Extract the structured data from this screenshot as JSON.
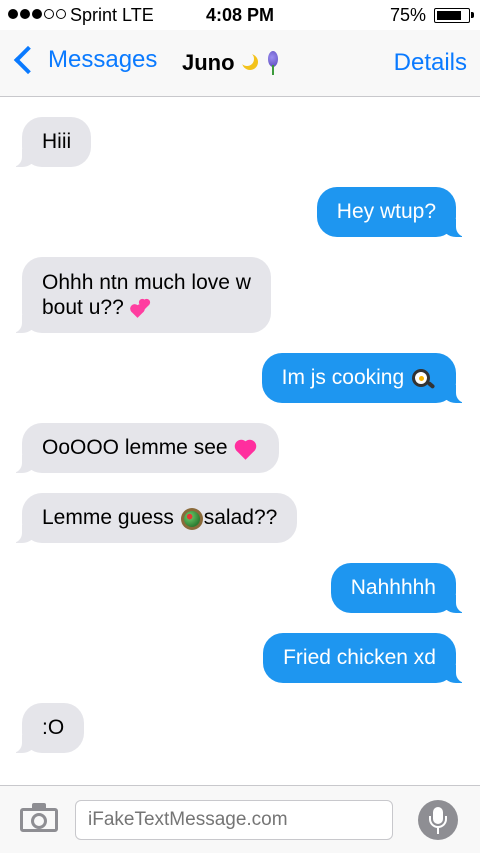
{
  "status_bar": {
    "carrier": "Sprint  LTE",
    "time": "4:08 PM",
    "battery_percent": "75%",
    "battery_level": 0.75,
    "signal_bars_filled": 3,
    "signal_bars_total": 5
  },
  "nav": {
    "back_label": "Messages",
    "contact_name": "Juno",
    "contact_emojis": [
      "crescent-moon-icon",
      "hyacinth-icon"
    ],
    "details_label": "Details",
    "accent_color": "#0a7aff"
  },
  "messages": [
    {
      "direction": "in",
      "text": "Hiii"
    },
    {
      "direction": "out",
      "text": "Hey wtup?"
    },
    {
      "direction": "in",
      "line1": "Ohhh ntn much love w",
      "line2": "bout u??",
      "emoji": "two-hearts-icon"
    },
    {
      "direction": "out",
      "text": "Im js cooking",
      "emoji": "frying-pan-egg-icon"
    },
    {
      "direction": "in",
      "text": "OoOOO lemme see",
      "emoji": "pink-heart-icon"
    },
    {
      "direction": "in",
      "text_before": "Lemme guess",
      "emoji": "salad-bowl-icon",
      "text_after": "salad??"
    },
    {
      "direction": "out",
      "text": "Nahhhhh"
    },
    {
      "direction": "out",
      "text": "Fried chicken xd"
    },
    {
      "direction": "in",
      "text": ":O"
    }
  ],
  "colors": {
    "incoming_bubble": "#e5e5ea",
    "outgoing_bubble": "#1e96f0"
  },
  "composer": {
    "placeholder": "iFakeTextMessage.com",
    "camera_icon": "camera-icon",
    "mic_icon": "microphone-icon"
  }
}
